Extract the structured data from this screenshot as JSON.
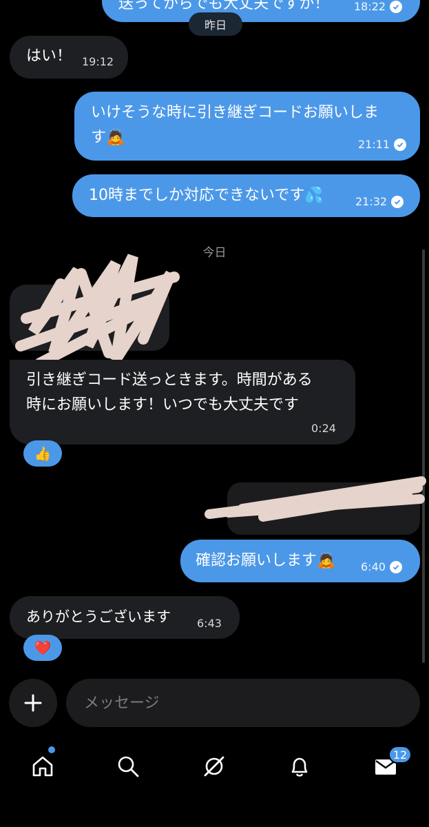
{
  "chat": {
    "top_partial": {
      "text": "送ってからでも大丈夫ですか！",
      "time": "18:22"
    },
    "date_yesterday": "昨日",
    "date_today": "今日",
    "messages": [
      {
        "text": "はい！",
        "time": "19:12"
      },
      {
        "text": "いけそうな時に引き継ぎコードお願いしま\nす🙇",
        "time": "21:11"
      },
      {
        "text": "10時までしか対応できないです💦",
        "time": "21:32"
      },
      {
        "text": "引き継ぎコード送っときます。時間がある\n時にお願いします！いつでも大丈夫です",
        "time": "0:24"
      },
      {
        "text": "確認お願いします🙇",
        "time": "6:40"
      },
      {
        "text": "ありがとうございます",
        "time": "6:43"
      }
    ],
    "reactions": {
      "thumbs": "👍",
      "heart": "❤️"
    }
  },
  "composer": {
    "placeholder": "メッセージ"
  },
  "tabbar": {
    "items": [
      "home",
      "search",
      "grok",
      "notifications",
      "messages"
    ],
    "messages_badge": "12"
  },
  "colors": {
    "sent": "#4c98e8",
    "received": "#1e1f22",
    "background": "#000000"
  }
}
